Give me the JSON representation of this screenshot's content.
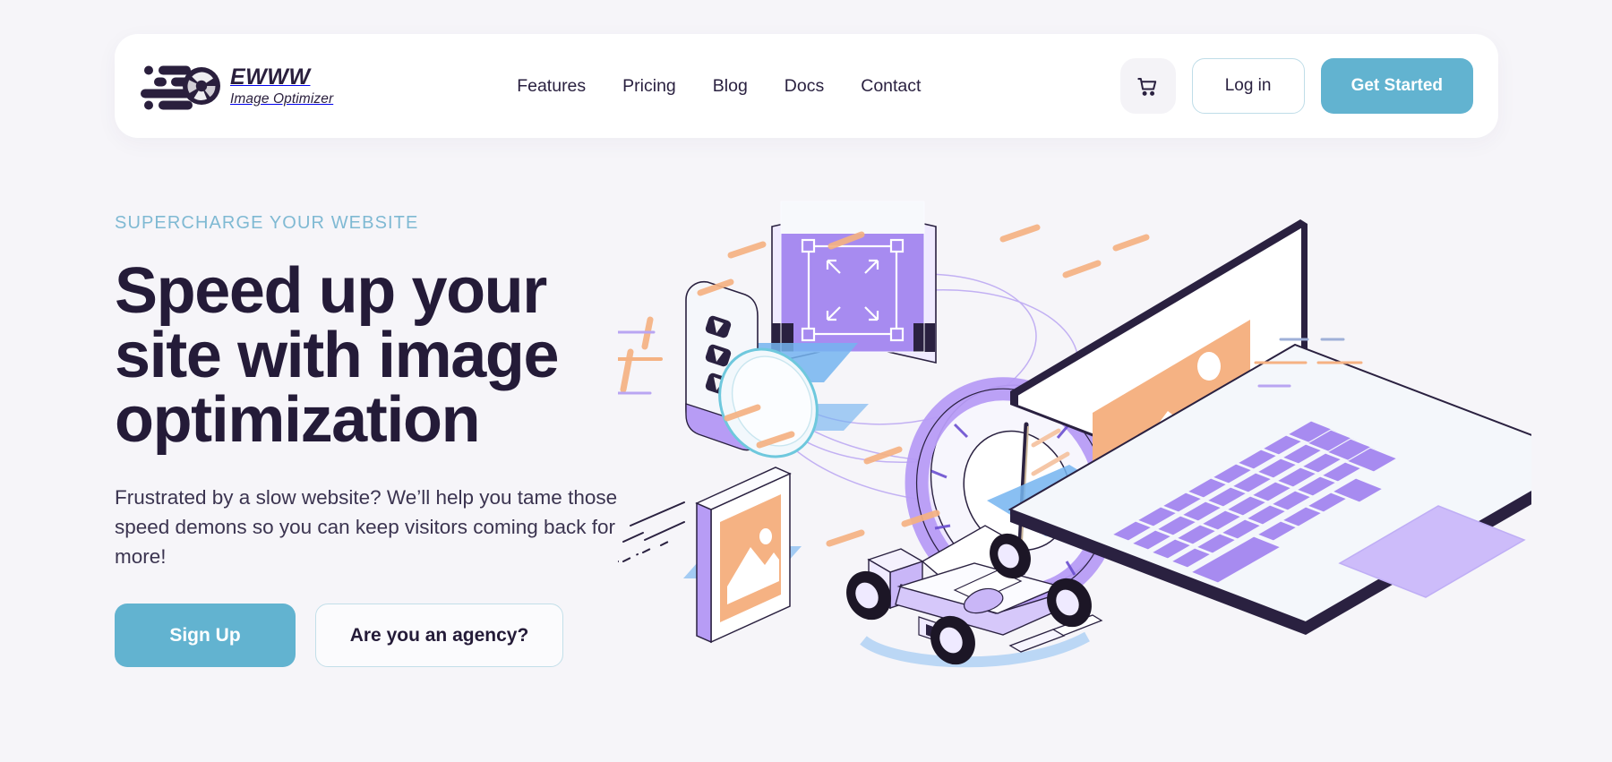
{
  "brand": {
    "name": "EWWW",
    "subtitle": "Image Optimizer",
    "logo_icon": "aperture-speed-logo"
  },
  "nav": {
    "items": [
      {
        "label": "Features"
      },
      {
        "label": "Pricing"
      },
      {
        "label": "Blog"
      },
      {
        "label": "Docs"
      },
      {
        "label": "Contact"
      }
    ]
  },
  "header_actions": {
    "cart_icon": "shopping-cart-icon",
    "login_label": "Log in",
    "get_started_label": "Get Started"
  },
  "hero": {
    "eyebrow": "SUPERCHARGE YOUR WEBSITE",
    "headline_line1": "Speed up your",
    "headline_line2": "site with image",
    "headline_line3": "optimization",
    "subhead": "Frustrated by a slow website? We’ll help you tame those speed demons so you can keep visitors coming back for more!",
    "primary_cta": "Sign Up",
    "secondary_cta": "Are you an agency?"
  },
  "illustration": {
    "name": "isometric-image-optimization-scene",
    "elements": [
      "purple-camera-roll",
      "crop-tool-overlay",
      "rounded-device-card",
      "speedometer-dial",
      "floating-image-card",
      "formula-race-car",
      "isometric-laptop",
      "speed-lines"
    ]
  },
  "colors": {
    "page_bg": "#f6f5f9",
    "card_bg": "#ffffff",
    "accent_teal": "#62b3d0",
    "eyebrow_teal": "#7fb9d3",
    "ink": "#241b38",
    "purple": "#a78bf0",
    "lavender": "#c9b6f7",
    "orange": "#f5b283",
    "blue_shadow": "#74b4f0"
  }
}
